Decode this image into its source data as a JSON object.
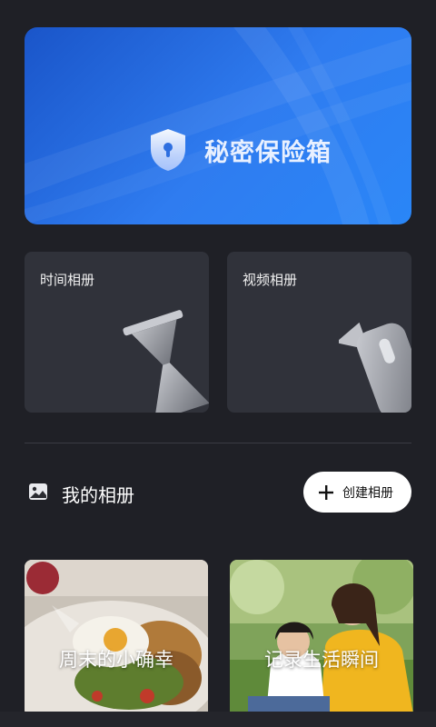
{
  "vault": {
    "title": "秘密保险箱"
  },
  "albums": [
    {
      "label": "时间相册",
      "icon": "hourglass-icon"
    },
    {
      "label": "视频相册",
      "icon": "camera-icon"
    }
  ],
  "my_albums": {
    "title": "我的相册",
    "create_label": "创建相册",
    "photos": [
      {
        "caption": "周末的小确幸"
      },
      {
        "caption": "记录生活瞬间"
      }
    ]
  },
  "colors": {
    "vault_blue": "#2f7cf0",
    "card_bg": "#30323a",
    "page_bg": "#1f2026"
  }
}
